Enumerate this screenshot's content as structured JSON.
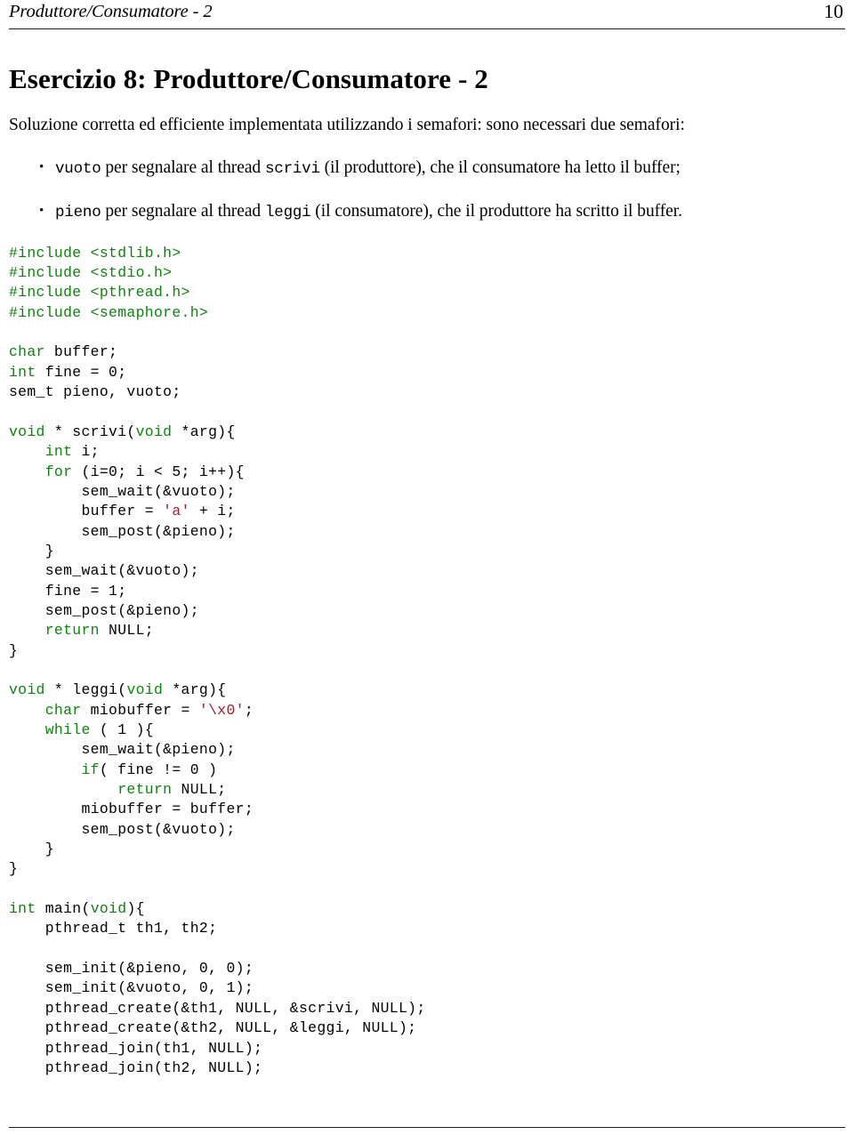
{
  "header": {
    "running_title": "Produttore/Consumatore - 2",
    "page_number": "10"
  },
  "section": {
    "title": "Esercizio 8:  Produttore/Consumatore - 2"
  },
  "body": {
    "intro": "Soluzione corretta ed efficiente implementata utilizzando i semafori: sono necessari due semafori:",
    "bullets": [
      {
        "code_1": "vuoto",
        "text_1": " per segnalare al thread ",
        "code_2": "scrivi",
        "text_2": " (il produttore), che il consumatore ha letto il buffer;"
      },
      {
        "code_1": "pieno",
        "text_1": " per segnalare al thread ",
        "code_2": "leggi",
        "text_2": " (il consumatore), che il produttore ha scritto il buffer."
      }
    ]
  },
  "colors": {
    "keyword": "#108010",
    "preprocessor": "#108010",
    "string_literal": "#9c2030",
    "text": "#000000",
    "rule": "#1a1a1a"
  },
  "code": {
    "language": "c",
    "lines": [
      [
        {
          "t": "#include <stdlib.h>",
          "c": "pre"
        }
      ],
      [
        {
          "t": "#include <stdio.h>",
          "c": "pre"
        }
      ],
      [
        {
          "t": "#include <pthread.h>",
          "c": "pre"
        }
      ],
      [
        {
          "t": "#include <semaphore.h>",
          "c": "pre"
        }
      ],
      [],
      [
        {
          "t": "char",
          "c": "kw"
        },
        {
          "t": " buffer;",
          "c": ""
        }
      ],
      [
        {
          "t": "int",
          "c": "kw"
        },
        {
          "t": " fine = 0;",
          "c": ""
        }
      ],
      [
        {
          "t": "sem_t pieno, vuoto;",
          "c": ""
        }
      ],
      [],
      [
        {
          "t": "void",
          "c": "kw"
        },
        {
          "t": " * scrivi(",
          "c": ""
        },
        {
          "t": "void",
          "c": "kw"
        },
        {
          "t": " *arg){",
          "c": ""
        }
      ],
      [
        {
          "t": "    ",
          "c": ""
        },
        {
          "t": "int",
          "c": "kw"
        },
        {
          "t": " i;",
          "c": ""
        }
      ],
      [
        {
          "t": "    ",
          "c": ""
        },
        {
          "t": "for",
          "c": "kw"
        },
        {
          "t": " (i=0; i < 5; i++){",
          "c": ""
        }
      ],
      [
        {
          "t": "        sem_wait(&vuoto);",
          "c": ""
        }
      ],
      [
        {
          "t": "        buffer = ",
          "c": ""
        },
        {
          "t": "'a'",
          "c": "str"
        },
        {
          "t": " + i;",
          "c": ""
        }
      ],
      [
        {
          "t": "        sem_post(&pieno);",
          "c": ""
        }
      ],
      [
        {
          "t": "    }",
          "c": ""
        }
      ],
      [
        {
          "t": "    sem_wait(&vuoto);",
          "c": ""
        }
      ],
      [
        {
          "t": "    fine = 1;",
          "c": ""
        }
      ],
      [
        {
          "t": "    sem_post(&pieno);",
          "c": ""
        }
      ],
      [
        {
          "t": "    ",
          "c": ""
        },
        {
          "t": "return",
          "c": "kw"
        },
        {
          "t": " NULL;",
          "c": ""
        }
      ],
      [
        {
          "t": "}",
          "c": ""
        }
      ],
      [],
      [
        {
          "t": "void",
          "c": "kw"
        },
        {
          "t": " * leggi(",
          "c": ""
        },
        {
          "t": "void",
          "c": "kw"
        },
        {
          "t": " *arg){",
          "c": ""
        }
      ],
      [
        {
          "t": "    ",
          "c": ""
        },
        {
          "t": "char",
          "c": "kw"
        },
        {
          "t": " miobuffer = ",
          "c": ""
        },
        {
          "t": "'\\x0'",
          "c": "str"
        },
        {
          "t": ";",
          "c": ""
        }
      ],
      [
        {
          "t": "    ",
          "c": ""
        },
        {
          "t": "while",
          "c": "kw"
        },
        {
          "t": " ( 1 ){",
          "c": ""
        }
      ],
      [
        {
          "t": "        sem_wait(&pieno);",
          "c": ""
        }
      ],
      [
        {
          "t": "        ",
          "c": ""
        },
        {
          "t": "if",
          "c": "kw"
        },
        {
          "t": "( fine != 0 )",
          "c": ""
        }
      ],
      [
        {
          "t": "            ",
          "c": ""
        },
        {
          "t": "return",
          "c": "kw"
        },
        {
          "t": " NULL;",
          "c": ""
        }
      ],
      [
        {
          "t": "        miobuffer = buffer;",
          "c": ""
        }
      ],
      [
        {
          "t": "        sem_post(&vuoto);",
          "c": ""
        }
      ],
      [
        {
          "t": "    }",
          "c": ""
        }
      ],
      [
        {
          "t": "}",
          "c": ""
        }
      ],
      [],
      [
        {
          "t": "int",
          "c": "kw"
        },
        {
          "t": " main(",
          "c": ""
        },
        {
          "t": "void",
          "c": "kw"
        },
        {
          "t": "){",
          "c": ""
        }
      ],
      [
        {
          "t": "    pthread_t th1, th2;",
          "c": ""
        }
      ],
      [],
      [
        {
          "t": "    sem_init(&pieno, 0, 0);",
          "c": ""
        }
      ],
      [
        {
          "t": "    sem_init(&vuoto, 0, 1);",
          "c": ""
        }
      ],
      [
        {
          "t": "    pthread_create(&th1, NULL, &scrivi, NULL);",
          "c": ""
        }
      ],
      [
        {
          "t": "    pthread_create(&th2, NULL, &leggi, NULL);",
          "c": ""
        }
      ],
      [
        {
          "t": "    pthread_join(th1, NULL);",
          "c": ""
        }
      ],
      [
        {
          "t": "    pthread_join(th2, NULL);",
          "c": ""
        }
      ]
    ]
  }
}
